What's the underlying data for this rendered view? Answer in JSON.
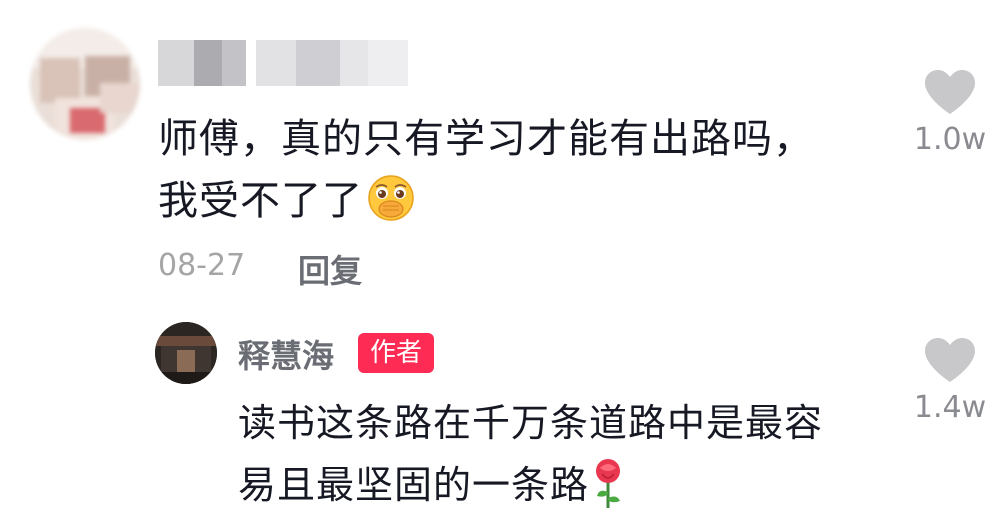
{
  "comment": {
    "text_line1": "师傅，真的只有学习才能有出路吗，",
    "text_line2": "我受不了了",
    "emoji": "face-with-hand-over-mouth-icon",
    "date": "08-27",
    "reply_label": "回复",
    "like_count": "1.0w"
  },
  "reply": {
    "username": "释慧海",
    "badge": "作者",
    "text_line1": "读书这条路在千万条道路中是最容",
    "text_line2": "易且最坚固的一条路",
    "emoji": "rose-icon",
    "like_count": "1.4w"
  },
  "colors": {
    "badge": "#fe2c55",
    "text": "#161823",
    "muted": "#a5a5a8",
    "like_icon": "#c8c8ca"
  }
}
